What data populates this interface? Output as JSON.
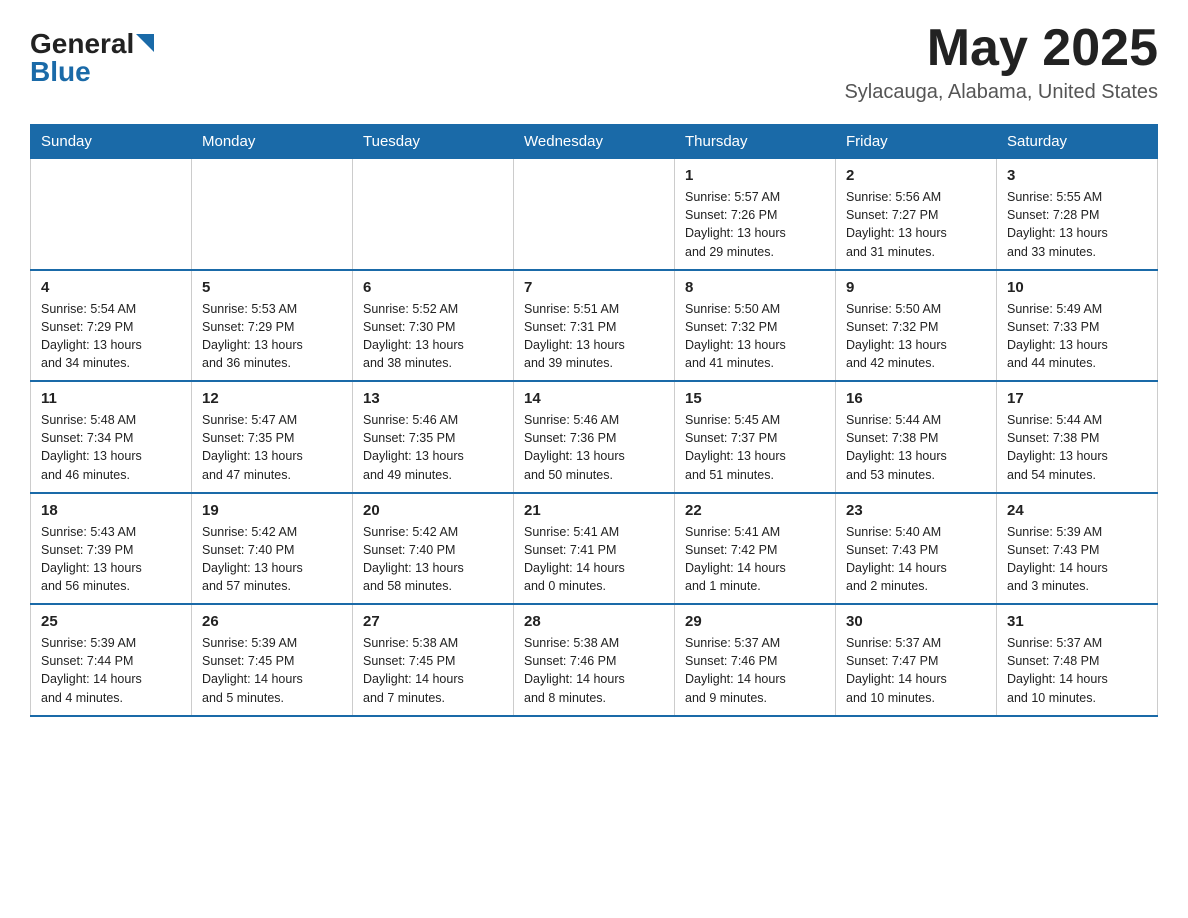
{
  "header": {
    "logo_line1": "General",
    "logo_line2": "Blue",
    "title": "May 2025",
    "subtitle": "Sylacauga, Alabama, United States"
  },
  "days_of_week": [
    "Sunday",
    "Monday",
    "Tuesday",
    "Wednesday",
    "Thursday",
    "Friday",
    "Saturday"
  ],
  "weeks": [
    [
      {
        "day": "",
        "info": ""
      },
      {
        "day": "",
        "info": ""
      },
      {
        "day": "",
        "info": ""
      },
      {
        "day": "",
        "info": ""
      },
      {
        "day": "1",
        "info": "Sunrise: 5:57 AM\nSunset: 7:26 PM\nDaylight: 13 hours\nand 29 minutes."
      },
      {
        "day": "2",
        "info": "Sunrise: 5:56 AM\nSunset: 7:27 PM\nDaylight: 13 hours\nand 31 minutes."
      },
      {
        "day": "3",
        "info": "Sunrise: 5:55 AM\nSunset: 7:28 PM\nDaylight: 13 hours\nand 33 minutes."
      }
    ],
    [
      {
        "day": "4",
        "info": "Sunrise: 5:54 AM\nSunset: 7:29 PM\nDaylight: 13 hours\nand 34 minutes."
      },
      {
        "day": "5",
        "info": "Sunrise: 5:53 AM\nSunset: 7:29 PM\nDaylight: 13 hours\nand 36 minutes."
      },
      {
        "day": "6",
        "info": "Sunrise: 5:52 AM\nSunset: 7:30 PM\nDaylight: 13 hours\nand 38 minutes."
      },
      {
        "day": "7",
        "info": "Sunrise: 5:51 AM\nSunset: 7:31 PM\nDaylight: 13 hours\nand 39 minutes."
      },
      {
        "day": "8",
        "info": "Sunrise: 5:50 AM\nSunset: 7:32 PM\nDaylight: 13 hours\nand 41 minutes."
      },
      {
        "day": "9",
        "info": "Sunrise: 5:50 AM\nSunset: 7:32 PM\nDaylight: 13 hours\nand 42 minutes."
      },
      {
        "day": "10",
        "info": "Sunrise: 5:49 AM\nSunset: 7:33 PM\nDaylight: 13 hours\nand 44 minutes."
      }
    ],
    [
      {
        "day": "11",
        "info": "Sunrise: 5:48 AM\nSunset: 7:34 PM\nDaylight: 13 hours\nand 46 minutes."
      },
      {
        "day": "12",
        "info": "Sunrise: 5:47 AM\nSunset: 7:35 PM\nDaylight: 13 hours\nand 47 minutes."
      },
      {
        "day": "13",
        "info": "Sunrise: 5:46 AM\nSunset: 7:35 PM\nDaylight: 13 hours\nand 49 minutes."
      },
      {
        "day": "14",
        "info": "Sunrise: 5:46 AM\nSunset: 7:36 PM\nDaylight: 13 hours\nand 50 minutes."
      },
      {
        "day": "15",
        "info": "Sunrise: 5:45 AM\nSunset: 7:37 PM\nDaylight: 13 hours\nand 51 minutes."
      },
      {
        "day": "16",
        "info": "Sunrise: 5:44 AM\nSunset: 7:38 PM\nDaylight: 13 hours\nand 53 minutes."
      },
      {
        "day": "17",
        "info": "Sunrise: 5:44 AM\nSunset: 7:38 PM\nDaylight: 13 hours\nand 54 minutes."
      }
    ],
    [
      {
        "day": "18",
        "info": "Sunrise: 5:43 AM\nSunset: 7:39 PM\nDaylight: 13 hours\nand 56 minutes."
      },
      {
        "day": "19",
        "info": "Sunrise: 5:42 AM\nSunset: 7:40 PM\nDaylight: 13 hours\nand 57 minutes."
      },
      {
        "day": "20",
        "info": "Sunrise: 5:42 AM\nSunset: 7:40 PM\nDaylight: 13 hours\nand 58 minutes."
      },
      {
        "day": "21",
        "info": "Sunrise: 5:41 AM\nSunset: 7:41 PM\nDaylight: 14 hours\nand 0 minutes."
      },
      {
        "day": "22",
        "info": "Sunrise: 5:41 AM\nSunset: 7:42 PM\nDaylight: 14 hours\nand 1 minute."
      },
      {
        "day": "23",
        "info": "Sunrise: 5:40 AM\nSunset: 7:43 PM\nDaylight: 14 hours\nand 2 minutes."
      },
      {
        "day": "24",
        "info": "Sunrise: 5:39 AM\nSunset: 7:43 PM\nDaylight: 14 hours\nand 3 minutes."
      }
    ],
    [
      {
        "day": "25",
        "info": "Sunrise: 5:39 AM\nSunset: 7:44 PM\nDaylight: 14 hours\nand 4 minutes."
      },
      {
        "day": "26",
        "info": "Sunrise: 5:39 AM\nSunset: 7:45 PM\nDaylight: 14 hours\nand 5 minutes."
      },
      {
        "day": "27",
        "info": "Sunrise: 5:38 AM\nSunset: 7:45 PM\nDaylight: 14 hours\nand 7 minutes."
      },
      {
        "day": "28",
        "info": "Sunrise: 5:38 AM\nSunset: 7:46 PM\nDaylight: 14 hours\nand 8 minutes."
      },
      {
        "day": "29",
        "info": "Sunrise: 5:37 AM\nSunset: 7:46 PM\nDaylight: 14 hours\nand 9 minutes."
      },
      {
        "day": "30",
        "info": "Sunrise: 5:37 AM\nSunset: 7:47 PM\nDaylight: 14 hours\nand 10 minutes."
      },
      {
        "day": "31",
        "info": "Sunrise: 5:37 AM\nSunset: 7:48 PM\nDaylight: 14 hours\nand 10 minutes."
      }
    ]
  ]
}
